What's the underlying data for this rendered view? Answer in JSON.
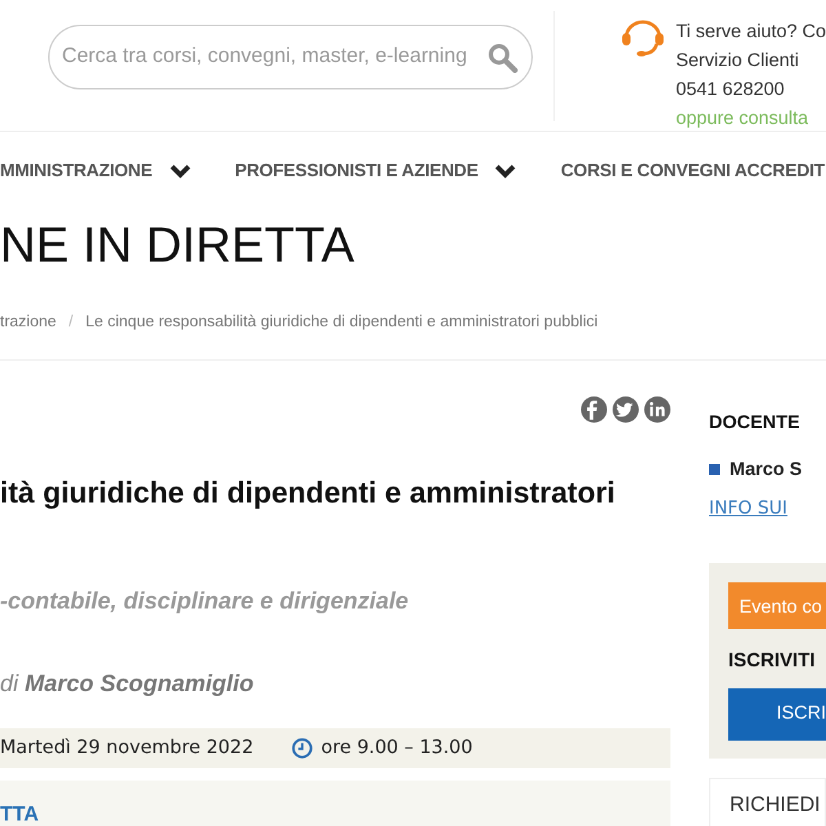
{
  "header": {
    "search": {
      "placeholder": "Cerca tra corsi, convegni, master, e-learning"
    },
    "help": {
      "lines": [
        "Ti serve aiuto? Co",
        "Servizio Clienti",
        "0541 628200"
      ],
      "link": "oppure consulta"
    }
  },
  "nav": [
    {
      "label": "MMINISTRAZIONE",
      "dropdown": true
    },
    {
      "label": "PROFESSIONISTI E AZIENDE",
      "dropdown": true
    },
    {
      "label": "CORSI E CONVEGNI ACCREDIT",
      "dropdown": false
    }
  ],
  "page_title": "NE IN DIRETTA",
  "breadcrumb_separator": "/",
  "breadcrumb": [
    "trazione",
    "Le cinque responsabilità giuridiche di dipendenti e amministratori pubblici"
  ],
  "event": {
    "title": "ità giuridiche di dipendenti e amministratori",
    "subtitle": "-contabile, disciplinare e dirigenziale",
    "author": "di **Marco Scognamiglio**",
    "date": "Martedì 29 novembre 2022",
    "time": "ore 9.00 – 13.00",
    "section": "TTA"
  },
  "sidebar": {
    "teacher_heading": "DOCENTE",
    "teachers": [
      "Marco S"
    ],
    "info_link": "INFO SUI",
    "notice": "Evento co",
    "subscribe_heading": "ISCRIVITI",
    "subscribe_button": "ISCRI",
    "request_heading": "RICHIEDI"
  }
}
